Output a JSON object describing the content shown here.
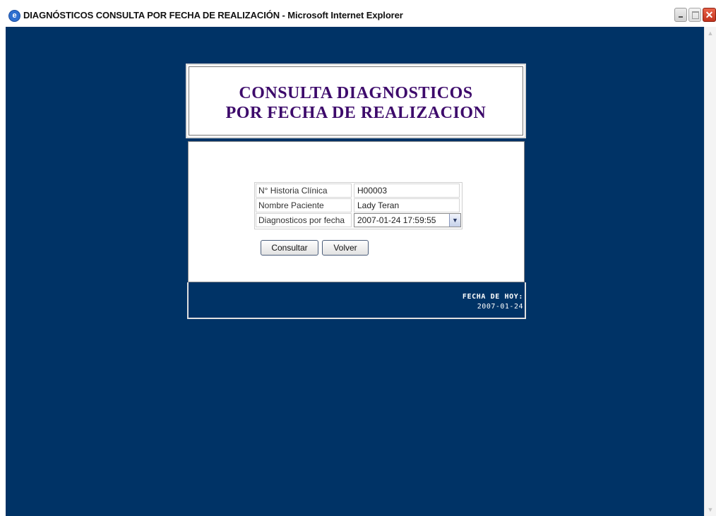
{
  "window": {
    "title": "DIAGNÓSTICOS CONSULTA POR FECHA DE REALIZACIÓN - Microsoft Internet Explorer",
    "icon": "ie-icon",
    "controls": {
      "minimize": "minimize-icon",
      "maximize": "maximize-icon",
      "close": "close-icon"
    }
  },
  "header": {
    "line1": "CONSULTA DIAGNOSTICOS",
    "line2": "POR FECHA DE REALIZACION",
    "color": "#3d0a6b"
  },
  "form": {
    "fields": [
      {
        "label": "N° Historia Clínica",
        "value": "H00003"
      },
      {
        "label": "Nombre Paciente",
        "value": "Lady Teran"
      },
      {
        "label": "Diagnosticos por fecha",
        "selected": "2007-01-24 17:59:55"
      }
    ],
    "consultar_label": "Consultar",
    "volver_label": "Volver"
  },
  "footer": {
    "label": "FECHA DE HOY:",
    "date": "2007-01-24"
  },
  "colors": {
    "page_background": "#003366",
    "panel_background": "#ffffff"
  }
}
